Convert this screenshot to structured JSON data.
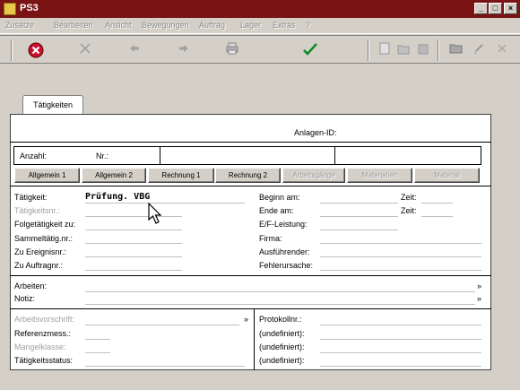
{
  "window": {
    "title": "PS3",
    "min": "_",
    "max": "□",
    "close": "×"
  },
  "menu": [
    "Zusätze",
    "Bearbeiten",
    "Ansicht",
    "Bewegungen",
    "Auftrag",
    "Lager",
    "Extras",
    "?"
  ],
  "toolbar": {
    "icons": [
      "cancel-icon",
      "close-icon",
      "back-icon",
      "forward-icon",
      "print-icon",
      "checkmark-icon",
      "new-icon",
      "folder-icon",
      "list-icon",
      "open-folder-icon",
      "edit-icon",
      "tools-icon"
    ]
  },
  "tab": {
    "label": "Tätigkeiten"
  },
  "header": {
    "anlagen_id_label": "Anlagen-ID:"
  },
  "row1": {
    "anzahl_label": "Anzahl:",
    "nr_label": "Nr.:"
  },
  "buttons": [
    "Allgemein 1",
    "Allgemein 2",
    "Rechnung 1",
    "Rechnung 2",
    "Arbeitsgänge",
    "Materialien",
    "Material"
  ],
  "left_fields": {
    "taetigkeit_label": "Tätigkeit:",
    "taetigkeit_value": "Prüfung. VBG",
    "taetigkeitsnr_label": "Tätigkeitsnr.:",
    "folge_label": "Folgetätigkeit zu:",
    "sammel_label": "Sammeltätig.nr.:",
    "ereignis_label": "Zu Ereignisnr.:",
    "auftrag_label": "Zu Auftragnr.:"
  },
  "right_fields": {
    "beginn_label": "Beginn am:",
    "zeit1_label": "Zeit:",
    "ende_label": "Ende am:",
    "zeit2_label": "Zeit:",
    "eif_label": "E/F-Leistung:",
    "firma_label": "Firma:",
    "ausfuehrender_label": "Ausführender:",
    "fehler_label": "Fehlerursache:"
  },
  "mid": {
    "arbeiten_label": "Arbeiten:",
    "notiz_label": "Notiz:",
    "more": "»"
  },
  "bottom_left": {
    "arbeitsvorschrift_label": "Arbeitsvorschrift:",
    "referenz_label": "Referenzmess.:",
    "mangel_label": "Mangelklasse:",
    "status_label": "Tätigkeitsstatus:",
    "more": "»"
  },
  "bottom_right": {
    "protokoll_label": "Protokollnr.:",
    "undef1_label": "(undefiniert):",
    "undef2_label": "(undefiniert):",
    "undef3_label": "(undefiniert):"
  }
}
